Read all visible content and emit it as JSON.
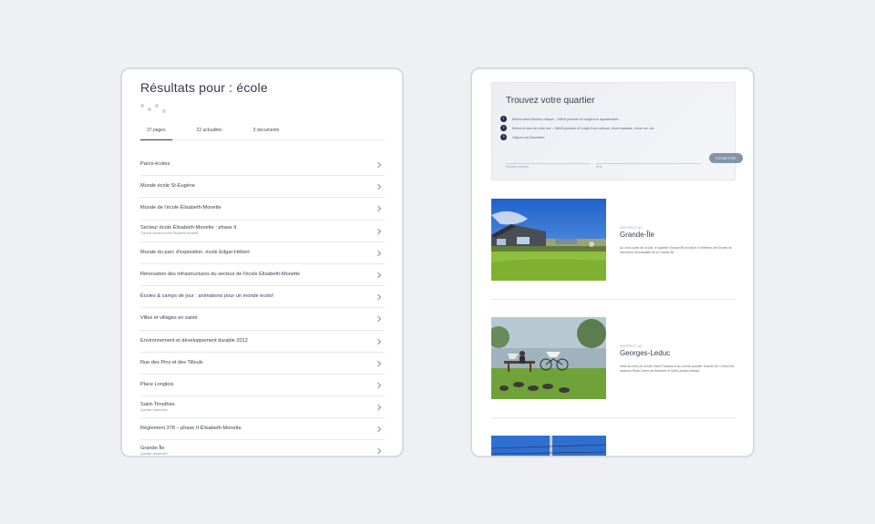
{
  "search": {
    "title": "Résultats pour : école",
    "tabs": [
      {
        "label": "37 pages",
        "active": true
      },
      {
        "label": "22 actualités",
        "active": false
      },
      {
        "label": "3 documents",
        "active": false
      }
    ],
    "results": [
      {
        "title": "Parcs-écoles",
        "subtitle": ""
      },
      {
        "title": "Murale école St-Eugène",
        "subtitle": ""
      },
      {
        "title": "Murale de l'école Élisabeth-Monette",
        "subtitle": ""
      },
      {
        "title": "Secteur école Élisabeth-Monette : phase II",
        "subtitle": "Travaux secteur école Élisabeth-Monette"
      },
      {
        "title": "Murale du parc d'exposition, école Edgar-Hébert",
        "subtitle": ""
      },
      {
        "title": "Rénovation des infrastructures du secteur de l'école Élisabeth-Monette",
        "subtitle": ""
      },
      {
        "title": "Écoles & camps de jour : animations pour un monde écolo!",
        "subtitle": ""
      },
      {
        "title": "Villes et villages en santé",
        "subtitle": ""
      },
      {
        "title": "Environnement et développement durable 2012",
        "subtitle": ""
      },
      {
        "title": "Rue des Pins et des Tilleuls",
        "subtitle": ""
      },
      {
        "title": "Place Longlois",
        "subtitle": ""
      },
      {
        "title": "Saint-Timothée",
        "subtitle": "Quartier résidentiel"
      },
      {
        "title": "Règlement 378 – phase II Élisabeth-Monette",
        "subtitle": ""
      },
      {
        "title": "Grande-Île",
        "subtitle": "Quartier résidentiel"
      }
    ]
  },
  "finder": {
    "title": "Trouvez votre quartier",
    "steps": [
      {
        "num": "1",
        "text": "Entrez votre Numéro civique – SANS préciser s'il s'agit d'un appartement."
      },
      {
        "num": "2",
        "text": "Entrez le nom de votre rue – SANS préciser s'il s'agit d'une avenue, d'une impasse, d'une rue, etc."
      },
      {
        "num": "3",
        "text": "Cliquez sur Soumettre"
      }
    ],
    "civic_placeholder": "Numéro civique",
    "street_placeholder": "Rue",
    "submit_label": "SOUMETTRE"
  },
  "districts": [
    {
      "eyebrow": "DISTRICT #1",
      "name": "Grande-Île",
      "description": "Au nord-ouest de la ville, le quartier Grande-Île est situé à l'intérieur des limites de l'ancienne Municipalité de la Grande-Île."
    },
    {
      "eyebrow": "DISTRICT #2",
      "name": "Georges-Leduc",
      "description": "Situé au nord de la baie Saint-François et au sud du quartier Grande-Île, il inclut les secteurs Notre-Dame-de-Bellerive et Saint-Joseph-Artisan."
    }
  ],
  "colors": {
    "accent": "#25294a",
    "button": "#8492ab",
    "card_border": "#d6dae1",
    "background": "#eef0f3"
  }
}
